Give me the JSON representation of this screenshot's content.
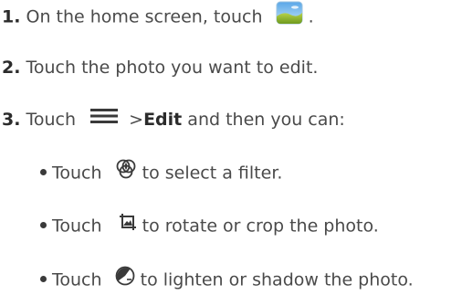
{
  "steps": [
    {
      "num": "1.",
      "text_before": "On the home screen, touch",
      "icon": "gallery-icon",
      "text_after": "."
    },
    {
      "num": "2.",
      "text": "Touch the photo you want to edit."
    },
    {
      "num": "3.",
      "text_before": "Touch",
      "icon": "menu-icon",
      "mid": ">",
      "bold": "Edit",
      "text_after": "and then you can:"
    }
  ],
  "bullets": [
    {
      "before": "Touch",
      "icon": "filter-icon",
      "after": "to select a filter."
    },
    {
      "before": "Touch",
      "icon": "crop-rotate-icon",
      "after": "to rotate or crop the photo."
    },
    {
      "before": "Touch",
      "icon": "lighten-shadow-icon",
      "after": "to lighten or shadow the photo."
    }
  ]
}
